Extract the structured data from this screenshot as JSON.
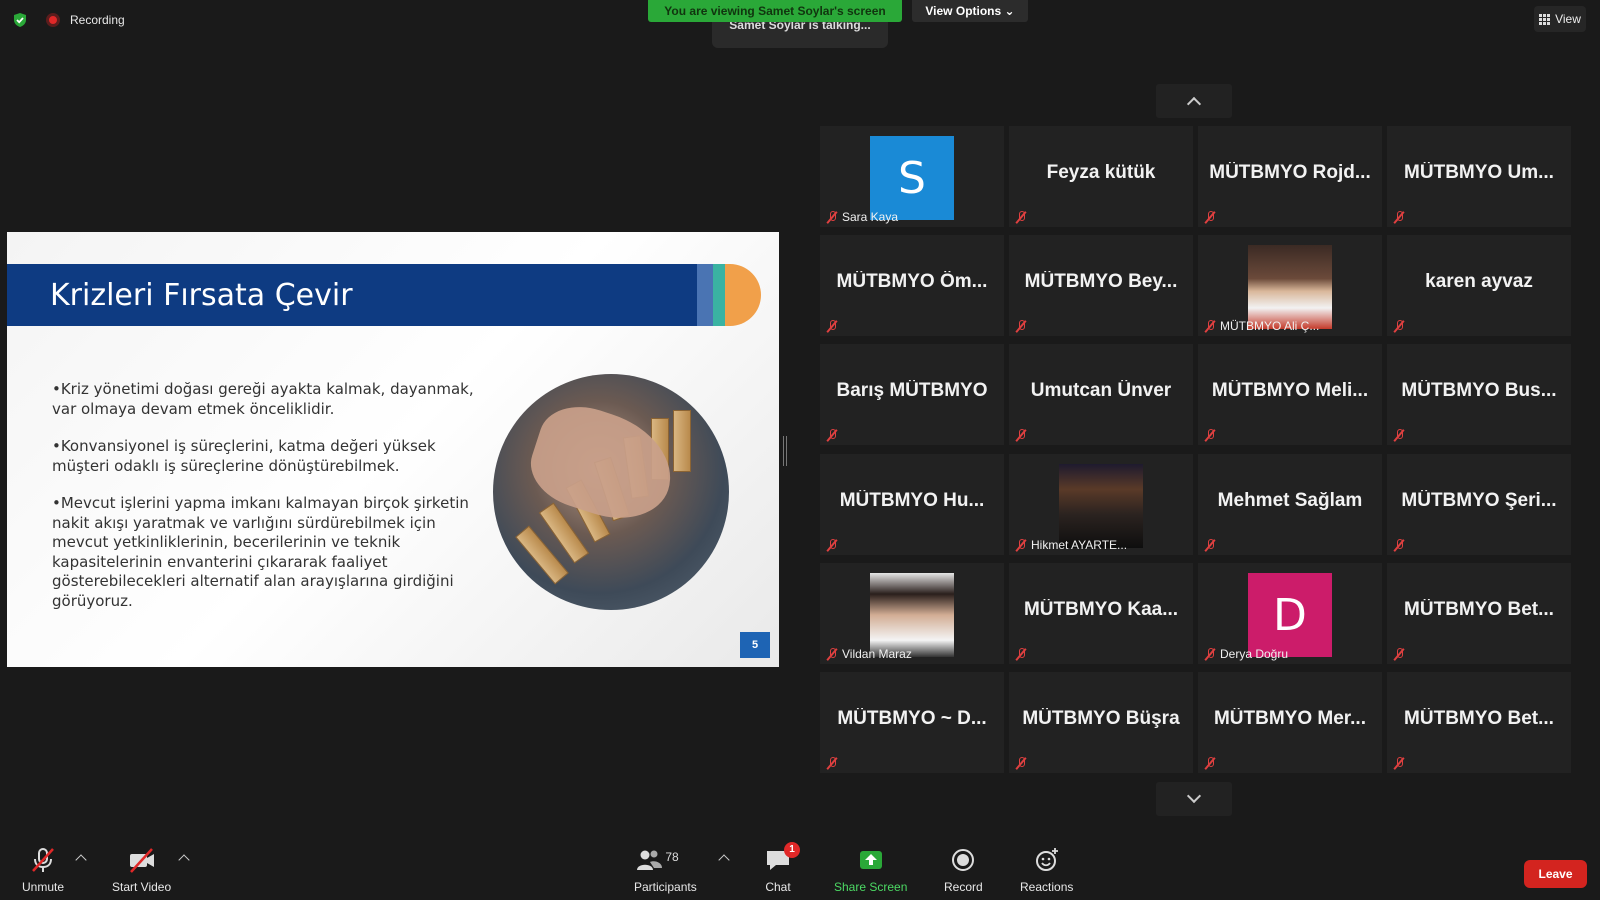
{
  "topbar": {
    "recording": "Recording",
    "viewing_banner": "You are viewing Samet Soylar's screen",
    "talking": "Samet Soylar is talking...",
    "view_options": "View Options",
    "view": "View"
  },
  "slide": {
    "title": "Krizleri Fırsata Çevir",
    "bullets": [
      "•Kriz yönetimi doğası gereği ayakta kalmak, dayanmak, var olmaya devam etmek önceliklidir.",
      "•Konvansiyonel iş süreçlerini, katma değeri yüksek müşteri odaklı iş süreçlerine dönüştürebilmek.",
      "•Mevcut işlerini yapma imkanı kalmayan birçok şirketin nakit akışı yaratmak ve varlığını sürdürebilmek için mevcut yetkinliklerinin, becerilerinin ve teknik kapasitelerinin envanterini çıkararak faaliyet gösterebilecekleri alternatif alan arayışlarına girdiğini görüyoruz."
    ],
    "page_number": "5"
  },
  "gallery": {
    "tiles": [
      {
        "kind": "avatar",
        "letter": "S",
        "color": "#1a8ad6",
        "label": "Sara Kaya"
      },
      {
        "kind": "name",
        "name": "Feyza kütük"
      },
      {
        "kind": "name",
        "name": "MÜTBMYO  Rojd..."
      },
      {
        "kind": "name",
        "name": "MÜTBMYO  Um..."
      },
      {
        "kind": "name",
        "name": "MÜTBMYO  Öm..."
      },
      {
        "kind": "name",
        "name": "MÜTBMYO  Bey..."
      },
      {
        "kind": "photo",
        "label": "MÜTBMYO Ali Ç..."
      },
      {
        "kind": "name",
        "name": "karen ayvaz"
      },
      {
        "kind": "name",
        "name": "Barış MÜTBMYO"
      },
      {
        "kind": "name",
        "name": "Umutcan Ünver"
      },
      {
        "kind": "name",
        "name": "MÜTBMYO  Meli..."
      },
      {
        "kind": "name",
        "name": "MÜTBMYO  Bus..."
      },
      {
        "kind": "name",
        "name": "MÜTBMYO  Hu..."
      },
      {
        "kind": "photo",
        "label": "Hikmet AYARTE..."
      },
      {
        "kind": "name",
        "name": "Mehmet Sağlam"
      },
      {
        "kind": "name",
        "name": "MÜTBMYO  Şeri..."
      },
      {
        "kind": "photo",
        "label": "Vildan Maraz"
      },
      {
        "kind": "name",
        "name": "MÜTBMYO  Kaa..."
      },
      {
        "kind": "avatar",
        "letter": "D",
        "color": "#cc1c6a",
        "label": "Derya Doğru"
      },
      {
        "kind": "name",
        "name": "MÜTBMYO  Bet..."
      },
      {
        "kind": "name",
        "name": "MÜTBMYO ~ D..."
      },
      {
        "kind": "name",
        "name": "MÜTBMYO Büşra"
      },
      {
        "kind": "name",
        "name": "MÜTBMYO  Mer..."
      },
      {
        "kind": "name",
        "name": "MÜTBMYO  Bet..."
      }
    ]
  },
  "toolbar": {
    "unmute": "Unmute",
    "start_video": "Start Video",
    "participants": "Participants",
    "participants_count": "78",
    "chat": "Chat",
    "chat_badge": "1",
    "share_screen": "Share Screen",
    "record": "Record",
    "reactions": "Reactions",
    "leave": "Leave"
  }
}
